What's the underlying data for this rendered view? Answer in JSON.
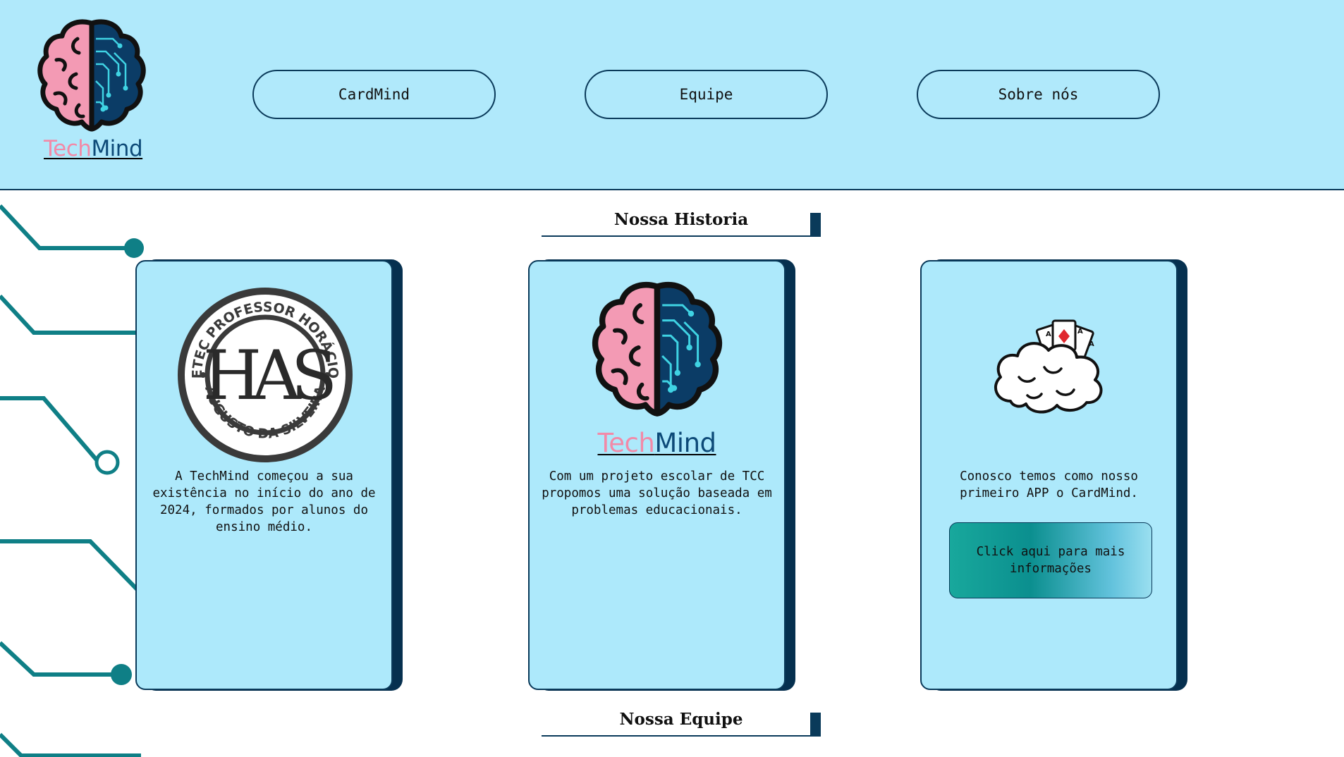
{
  "header": {
    "logo": {
      "text_part1": "Tech",
      "text_part2": "Mind",
      "icon": "brain-circuit-icon"
    },
    "nav": [
      {
        "label": "CardMind"
      },
      {
        "label": "Equipe"
      },
      {
        "label": "Sobre nós"
      }
    ]
  },
  "sections": {
    "history_title": "Nossa Historia",
    "team_title": "Nossa Equipe"
  },
  "cards": [
    {
      "image": "etec-seal-logo",
      "seal_text_top": "ETEC PROFESSOR HORÁCIO",
      "seal_text_bottom": "AUGUSTO DA SILVEIRA",
      "seal_monogram": "HAS",
      "text": "A TechMind começou a sua existência no início do ano de 2024, formados por alunos do ensino médio."
    },
    {
      "image": "techmind-logo",
      "logo_text_part1": "Tech",
      "logo_text_part2": "Mind",
      "text": "Com um projeto escolar de TCC propomos uma solução baseada em problemas educacionais."
    },
    {
      "image": "cardmind-cloud-icon",
      "text": "Conosco temos como nosso primeiro APP o CardMind.",
      "button_label": "Click aqui para mais informações"
    }
  ],
  "colors": {
    "header_bg": "#b0e9fb",
    "card_bg": "#ade9fb",
    "navy": "#0a3a5a",
    "pink": "#f28aa8",
    "teal": "#0f7f86"
  }
}
